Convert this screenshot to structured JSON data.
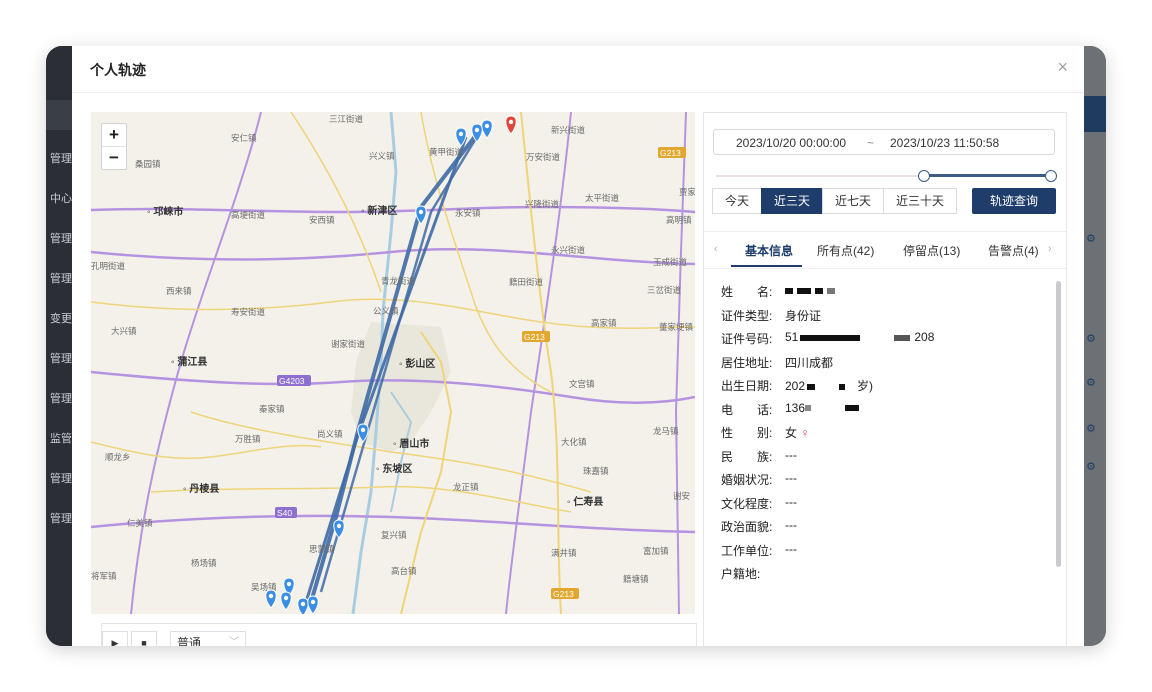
{
  "background_nav": [
    "管理",
    "中心",
    "管理",
    "管理",
    "变更",
    "管理",
    "管理",
    "监管",
    "管理",
    "管理"
  ],
  "modal": {
    "title": "个人轨迹",
    "close": "×"
  },
  "map": {
    "zoom_in": "+",
    "zoom_out": "−",
    "labels": [
      "三江街道",
      "安仁镇",
      "新兴街道",
      "黄甲街道",
      "兴义镇",
      "万安街道",
      "桑园镇",
      "邛崃市",
      "高埂街道",
      "安西镇",
      "新津区",
      "永安镇",
      "兴隆街道",
      "太平街道",
      "贾家",
      "高明镇",
      "永兴街道",
      "玉成街道",
      "孔明街道",
      "青龙街道",
      "籍田街道",
      "三岔街道",
      "西来镇",
      "寿安街道",
      "公义镇",
      "大兴镇",
      "谢家街道",
      "高家镇",
      "董家埂镇",
      "蒲江县",
      "彭山区",
      "文宫镇",
      "G4203",
      "秦家镇",
      "万胜镇",
      "尚义镇",
      "眉山市",
      "大化镇",
      "龙马镇",
      "顺龙乡",
      "东坡区",
      "珠嘉镇",
      "丹棱县",
      "龙正镇",
      "仁寿县",
      "谢安",
      "仁美镇",
      "S40",
      "复兴镇",
      "思蒙镇",
      "满井镇",
      "富加镇",
      "杨场镇",
      "高台镇",
      "吴场镇",
      "将军镇",
      "籍塘镇",
      "G213",
      "G213",
      "G213"
    ]
  },
  "playbar": {
    "play": "▶",
    "stop": "■",
    "speed": "普通"
  },
  "filter": {
    "start": "2023/10/20 00:00:00",
    "separator": "~",
    "end": "2023/10/23 11:50:58",
    "ranges": [
      "今天",
      "近三天",
      "近七天",
      "近三十天"
    ],
    "active_range": "近三天",
    "query": "轨迹查询"
  },
  "tabs": [
    "基本信息",
    "所有点(42)",
    "停留点(13)",
    "告警点(4)"
  ],
  "info": [
    {
      "label": "姓　　名:",
      "value": ""
    },
    {
      "label": "证件类型:",
      "value": "身份证"
    },
    {
      "label": "证件号码:",
      "value_prefix": "51",
      "value_suffix": "208"
    },
    {
      "label": "居住地址:",
      "value": "四川成都"
    },
    {
      "label": "出生日期:",
      "value_prefix": "202",
      "value_suffix": "岁)"
    },
    {
      "label": "电　　话:",
      "value_prefix": "136",
      "value_suffix": ""
    },
    {
      "label": "性　　别:",
      "value": "女",
      "symbol": "♀"
    },
    {
      "label": "民　　族:",
      "value": "---"
    },
    {
      "label": "婚姻状况:",
      "value": "---"
    },
    {
      "label": "文化程度:",
      "value": "---"
    },
    {
      "label": "政治面貌:",
      "value": "---"
    },
    {
      "label": "工作单位:",
      "value": "---"
    },
    {
      "label": "户籍地:",
      "value": ""
    }
  ],
  "colors": {
    "accent": "#1f3d6b",
    "route": "#3f6aa6",
    "marker": "#3b8ee4",
    "end_marker": "#e0473a"
  }
}
